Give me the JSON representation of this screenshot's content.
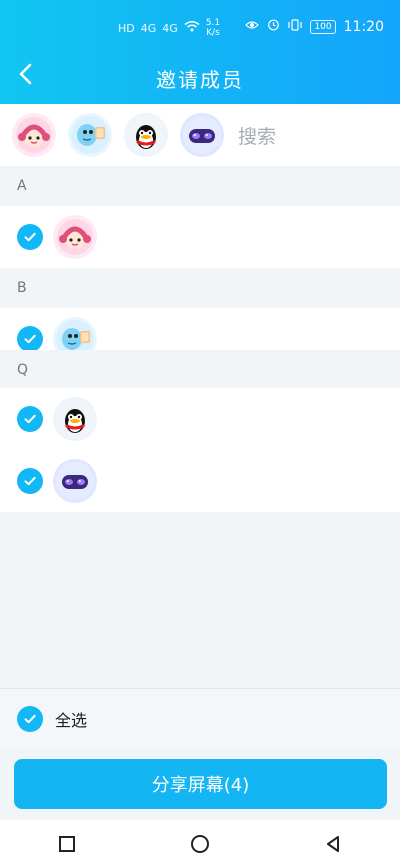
{
  "status_bar": {
    "left_icons": [
      "hd-icon",
      "signal-4g-icon",
      "signal-4g-icon",
      "wifi-icon"
    ],
    "left_labels": [
      "HD",
      "4G",
      "4G"
    ],
    "net_speed_value": "5.1",
    "net_speed_unit": "K/s",
    "right_icons": [
      "eye-icon",
      "alarm-icon",
      "vibrate-icon"
    ],
    "battery": "100",
    "time": "11:20"
  },
  "header": {
    "title": "邀请成员",
    "back_icon": "chevron-left-icon"
  },
  "selected": {
    "search_placeholder": "搜索",
    "avatars": [
      "girl-avatar",
      "dino-avatar",
      "penguin-avatar",
      "robot-avatar"
    ]
  },
  "sections": [
    {
      "letter": "A",
      "items": [
        {
          "avatar": "girl-avatar",
          "checked": true
        }
      ]
    },
    {
      "letter": "B",
      "items": [
        {
          "avatar": "dino-avatar",
          "checked": true
        }
      ]
    },
    {
      "letter": "Q",
      "items": [
        {
          "avatar": "penguin-avatar",
          "checked": true
        },
        {
          "avatar": "robot-avatar",
          "checked": true
        }
      ]
    }
  ],
  "footer": {
    "select_all_label": "全选",
    "share_button_label": "分享屏幕(4)"
  },
  "nav": {
    "icons": [
      "recent-apps-icon",
      "home-icon",
      "back-icon"
    ]
  },
  "colors": {
    "accent": "#13b6f2",
    "header_start": "#12c6f2",
    "header_end": "#14a5fb",
    "background": "#f2f5f8"
  }
}
